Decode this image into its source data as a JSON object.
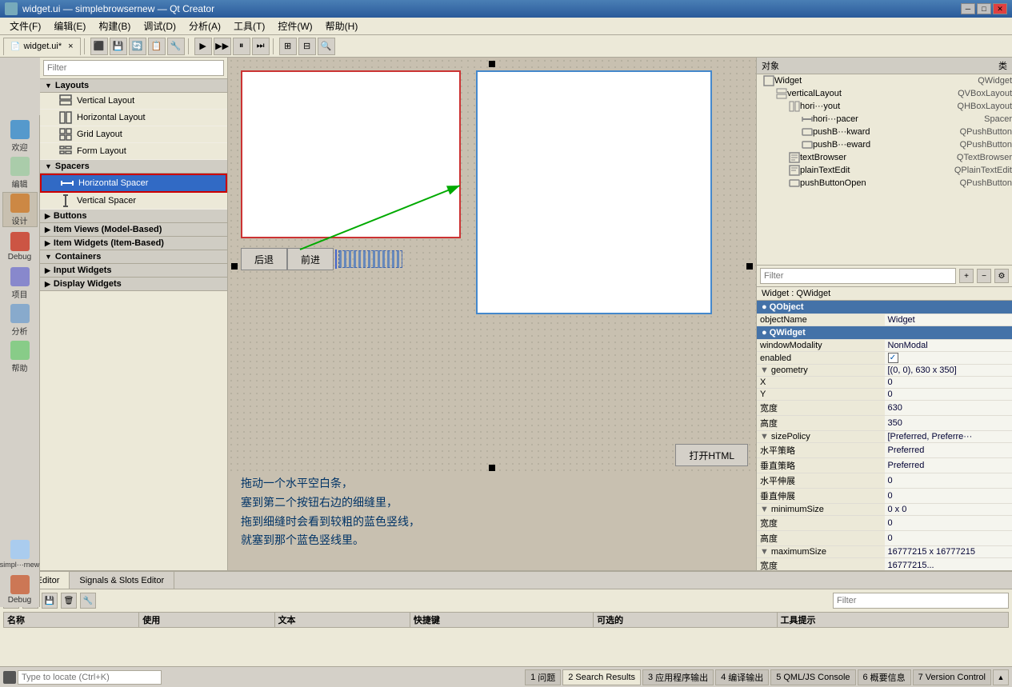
{
  "titlebar": {
    "title": "widget.ui — simplebrowsernew — Qt Creator",
    "icon": "qt-icon"
  },
  "menubar": {
    "items": [
      {
        "label": "文件(F)",
        "id": "file-menu"
      },
      {
        "label": "编辑(E)",
        "id": "edit-menu"
      },
      {
        "label": "构建(B)",
        "id": "build-menu"
      },
      {
        "label": "调试(D)",
        "id": "debug-menu"
      },
      {
        "label": "分析(A)",
        "id": "analyze-menu"
      },
      {
        "label": "工具(T)",
        "id": "tools-menu"
      },
      {
        "label": "控件(W)",
        "id": "controls-menu"
      },
      {
        "label": "帮助(H)",
        "id": "help-menu"
      }
    ]
  },
  "toolbar": {
    "tab_label": "widget.ui*",
    "close_label": "×"
  },
  "left_panel": {
    "filter_placeholder": "Filter",
    "sections": [
      {
        "id": "layouts",
        "label": "Layouts",
        "items": [
          {
            "label": "Vertical Layout",
            "icon": "vertical-layout-icon"
          },
          {
            "label": "Horizontal Layout",
            "icon": "horizontal-layout-icon"
          },
          {
            "label": "Grid Layout",
            "icon": "grid-layout-icon"
          },
          {
            "label": "Form Layout",
            "icon": "form-layout-icon"
          }
        ]
      },
      {
        "id": "spacers",
        "label": "Spacers",
        "items": [
          {
            "label": "Horizontal Spacer",
            "icon": "horizontal-spacer-icon",
            "selected": true
          },
          {
            "label": "Vertical Spacer",
            "icon": "vertical-spacer-icon"
          }
        ]
      },
      {
        "id": "buttons",
        "label": "Buttons",
        "items": []
      },
      {
        "id": "item-views",
        "label": "Item Views (Model-Based)",
        "items": []
      },
      {
        "id": "item-widgets",
        "label": "Item Widgets (Item-Based)",
        "items": []
      },
      {
        "id": "containers",
        "label": "Containers",
        "items": []
      },
      {
        "id": "input-widgets",
        "label": "Input Widgets",
        "items": []
      },
      {
        "id": "display-widgets",
        "label": "Display Widgets",
        "items": []
      }
    ]
  },
  "sidebar_icons": [
    {
      "label": "欢迎",
      "id": "welcome-icon"
    },
    {
      "label": "编辑",
      "id": "edit-icon"
    },
    {
      "label": "设计",
      "id": "design-icon"
    },
    {
      "label": "Debug",
      "id": "debug-icon"
    },
    {
      "label": "项目",
      "id": "project-icon"
    },
    {
      "label": "分析",
      "id": "analyze-icon"
    },
    {
      "label": "帮助",
      "id": "help-icon"
    }
  ],
  "canvas": {
    "button_back": "后退",
    "button_forward": "前进",
    "button_open_html": "打开HTML",
    "instruction_line1": "拖动一个水平空白条，",
    "instruction_line2": "塞到第二个按钮右边的细缝里，",
    "instruction_line3": "拖到细缝时会看到较粗的蓝色竖线，",
    "instruction_line4": "就塞到那个蓝色竖线里。"
  },
  "right_panel": {
    "header_object": "对象",
    "header_class": "类",
    "objects": [
      {
        "indent": 1,
        "name": "Widget",
        "class": "QWidget",
        "icon": "widget-icon"
      },
      {
        "indent": 2,
        "name": "verticalLayout",
        "class": "QVBoxLayout",
        "icon": "vlayout-icon"
      },
      {
        "indent": 3,
        "name": "hori···yout",
        "class": "QHBoxLayout",
        "icon": "hlayout-icon"
      },
      {
        "indent": 4,
        "name": "hori···pacer",
        "class": "Spacer",
        "icon": "spacer-icon"
      },
      {
        "indent": 4,
        "name": "pushB···kward",
        "class": "QPushButton",
        "icon": "button-icon"
      },
      {
        "indent": 4,
        "name": "pushB···eward",
        "class": "QPushButton",
        "icon": "button-icon"
      },
      {
        "indent": 3,
        "name": "textBrowser",
        "class": "QTextBrowser",
        "icon": "textbrowser-icon"
      },
      {
        "indent": 3,
        "name": "plainTextEdit",
        "class": "QPlainTextEdit",
        "icon": "textedit-icon"
      },
      {
        "indent": 3,
        "name": "pushButtonOpen",
        "class": "QPushButton",
        "icon": "button-icon"
      }
    ],
    "props_filter_placeholder": "Filter",
    "widget_type": "Widget : QWidget",
    "properties": [
      {
        "section": "QObject"
      },
      {
        "name": "objectName",
        "value": "Widget",
        "indent": 0
      },
      {
        "section": "QWidget"
      },
      {
        "name": "windowModality",
        "value": "NonModal",
        "indent": 0
      },
      {
        "name": "enabled",
        "value": "✓",
        "indent": 0,
        "is_checkbox": true
      },
      {
        "name": "geometry",
        "value": "[(0, 0), 630 x 350]",
        "indent": 0,
        "expandable": true
      },
      {
        "name": "X",
        "value": "0",
        "indent": 1
      },
      {
        "name": "Y",
        "value": "0",
        "indent": 1
      },
      {
        "name": "宽度",
        "value": "630",
        "indent": 1
      },
      {
        "name": "高度",
        "value": "350",
        "indent": 1
      },
      {
        "name": "sizePolicy",
        "value": "[Preferred, Preferre···",
        "indent": 0,
        "expandable": true
      },
      {
        "name": "水平策略",
        "value": "Preferred",
        "indent": 1
      },
      {
        "name": "垂直策略",
        "value": "Preferred",
        "indent": 1
      },
      {
        "name": "水平伸展",
        "value": "0",
        "indent": 1
      },
      {
        "name": "垂直伸展",
        "value": "0",
        "indent": 1
      },
      {
        "name": "minimumSize",
        "value": "0 x 0",
        "indent": 0,
        "expandable": true
      },
      {
        "name": "宽度",
        "value": "0",
        "indent": 1
      },
      {
        "name": "高度",
        "value": "0",
        "indent": 1
      },
      {
        "name": "maximumSize",
        "value": "16777215 x 16777215",
        "indent": 0,
        "expandable": true
      },
      {
        "name": "宽度",
        "value": "16777215...",
        "indent": 1
      }
    ]
  },
  "bottom_panel": {
    "tabs": [
      {
        "label": "Action Editor",
        "active": true
      },
      {
        "label": "Signals & Slots Editor",
        "active": false
      }
    ],
    "table_headers": [
      "名称",
      "使用",
      "文本",
      "快捷键",
      "可选的",
      "工具提示"
    ]
  },
  "status_bar": {
    "search_placeholder": "Type to locate (Ctrl+K)",
    "tabs": [
      {
        "num": "1",
        "label": "问题"
      },
      {
        "num": "2",
        "label": "Search Results",
        "active": true
      },
      {
        "num": "3",
        "label": "应用程序输出"
      },
      {
        "num": "4",
        "label": "编译输出"
      },
      {
        "num": "5",
        "label": "QML/JS Console"
      },
      {
        "num": "6",
        "label": "概要信息"
      },
      {
        "num": "7",
        "label": "Version Control"
      }
    ],
    "arrow_up": "▲"
  }
}
